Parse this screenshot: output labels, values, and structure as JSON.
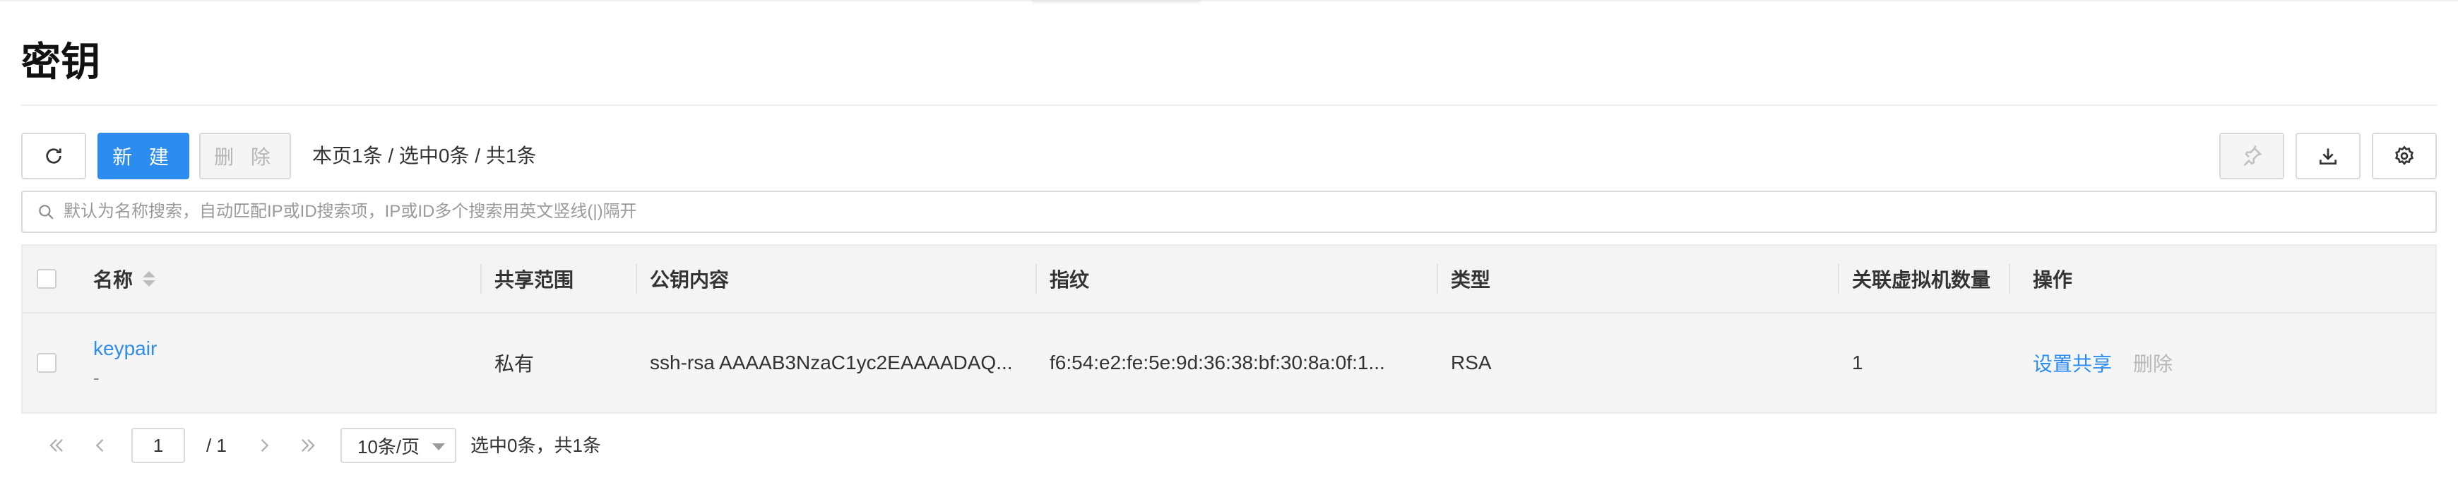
{
  "page": {
    "title": "密钥"
  },
  "toolbar": {
    "new_label": "新 建",
    "delete_label": "删 除",
    "count_text": "本页1条 / 选中0条 / 共1条"
  },
  "search": {
    "placeholder": "默认为名称搜索，自动匹配IP或ID搜索项，IP或ID多个搜索用英文竖线(|)隔开"
  },
  "table": {
    "headers": {
      "name": "名称",
      "share_scope": "共享范围",
      "public_key": "公钥内容",
      "fingerprint": "指纹",
      "type": "类型",
      "vm_count": "关联虚拟机数量",
      "actions": "操作"
    },
    "rows": [
      {
        "name": "keypair",
        "description": "-",
        "share_scope": "私有",
        "public_key": "ssh-rsa AAAAB3NzaC1yc2EAAAADAQ...",
        "fingerprint": "f6:54:e2:fe:5e:9d:36:38:bf:30:8a:0f:1...",
        "type": "RSA",
        "vm_count": "1",
        "action_share": "设置共享",
        "action_delete": "删除"
      }
    ]
  },
  "pagination": {
    "current_page": "1",
    "total_pages": "/ 1",
    "page_size": "10条/页",
    "selected_text": "选中0条，共1条"
  },
  "colors": {
    "primary": "#2d8cf0",
    "disabled_text": "#b5b5b5"
  }
}
